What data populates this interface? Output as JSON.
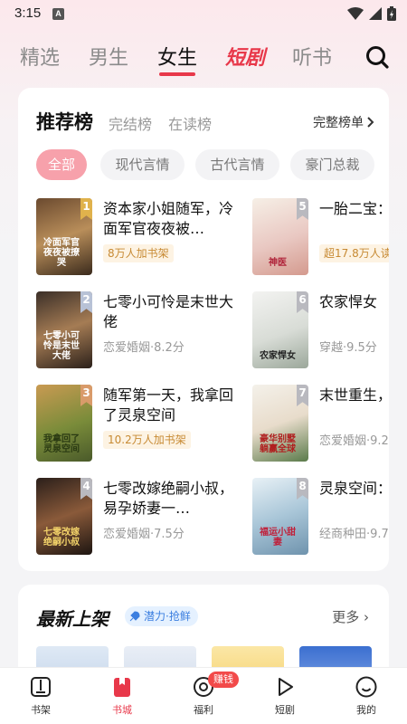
{
  "status_bar": {
    "time": "3:15",
    "notification_letter": "A"
  },
  "top_tabs": [
    {
      "label": "精选"
    },
    {
      "label": "男生"
    },
    {
      "label": "女生"
    },
    {
      "label": "短剧"
    },
    {
      "label": "听书"
    }
  ],
  "ranking": {
    "title": "推荐榜",
    "sub_tabs": [
      "完结榜",
      "在读榜"
    ],
    "more_label": "完整榜单",
    "categories": [
      "全部",
      "现代言情",
      "古代言情",
      "豪门总裁"
    ],
    "books": [
      {
        "rank": "1",
        "title": "资本家小姐随军，冷面军官夜夜被…",
        "info": "8万人加书架",
        "cover_text": "冷面军官夜夜被撩哭"
      },
      {
        "rank": "2",
        "title": "七零小可怜是末世大佬",
        "info": "恋爱婚姻·8.2分",
        "cover_text": "七零小可怜是末世大佬"
      },
      {
        "rank": "3",
        "title": "随军第一天，我拿回了灵泉空间",
        "info": "10.2万人加书架",
        "cover_text": "我拿回了灵泉空间"
      },
      {
        "rank": "4",
        "title": "七零改嫁绝嗣小叔，易孕娇妻一…",
        "info": "恋爱婚姻·7.5分",
        "cover_text": "七零改嫁绝嗣小叔"
      },
      {
        "rank": "5",
        "title": "一胎二宝：神医",
        "info": "超17.8万人读",
        "cover_text": "神医"
      },
      {
        "rank": "6",
        "title": "农家悍女",
        "info": "穿越·9.5分",
        "cover_text": "农家悍女"
      },
      {
        "rank": "7",
        "title": "末世重生，华别墅躺",
        "info": "恋爱婚姻·9.2",
        "cover_text": "豪华别墅躺赢全球"
      },
      {
        "rank": "8",
        "title": "灵泉空间：运妻",
        "info": "经商种田·9.7",
        "cover_text": "福运小甜妻"
      }
    ]
  },
  "new_arrivals": {
    "title": "最新上架",
    "tag": "潜力·抢鲜",
    "more_label": "更多"
  },
  "bottom_nav": [
    {
      "label": "书架"
    },
    {
      "label": "书城"
    },
    {
      "label": "福利",
      "badge": "赚钱"
    },
    {
      "label": "短剧"
    },
    {
      "label": "我的"
    }
  ],
  "colors": {
    "accent": "#e8384a",
    "gold": "#c78a33",
    "muted": "#999999"
  }
}
